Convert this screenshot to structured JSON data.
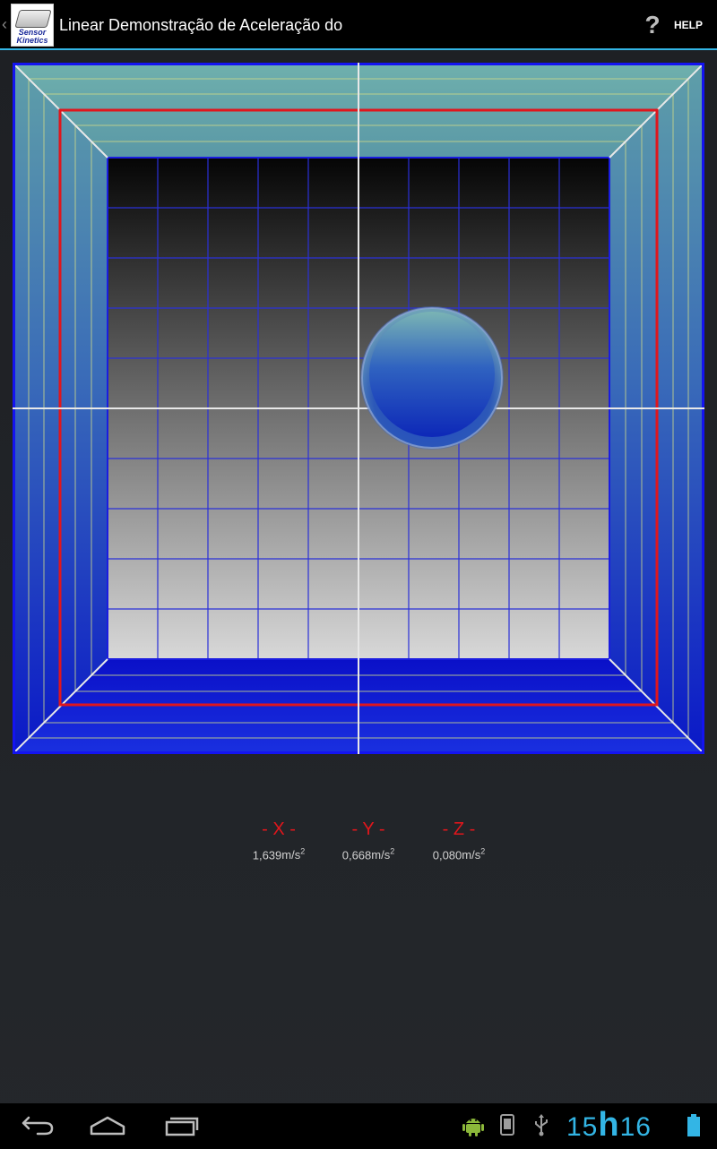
{
  "actionbar": {
    "title": "Linear Demonstração de Aceleração do",
    "icon_text_line1": "Sensor",
    "icon_text_line2": "Kinetics",
    "help_glyph": "?",
    "help_label": "HELP",
    "accent_color": "#33b5e5"
  },
  "readings": [
    {
      "label": "- X -",
      "value": "1,639",
      "unit": "m/s",
      "exp": "2"
    },
    {
      "label": "- Y -",
      "value": "0,668",
      "unit": "m/s",
      "exp": "2"
    },
    {
      "label": "- Z -",
      "value": "0,080",
      "unit": "m/s",
      "exp": "2"
    }
  ],
  "statusbar": {
    "hours": "15",
    "sep": "h",
    "minutes": "16",
    "clock_color": "#33b5e5"
  },
  "icons": {
    "back": "back-icon",
    "home": "home-icon",
    "recents": "recents-icon",
    "android_debug": "android-debug-icon",
    "device_notification": "device-icon",
    "usb": "usb-icon",
    "battery": "battery-icon"
  },
  "viz_colors": {
    "frame_outer": "#0a10d8",
    "frame_inner_top": "#6aa8a8",
    "frame_side": "#1a2bb0",
    "target_rect": "#e0161c",
    "crosshair": "#e8e8e8",
    "ball": "#2a4ec0"
  }
}
